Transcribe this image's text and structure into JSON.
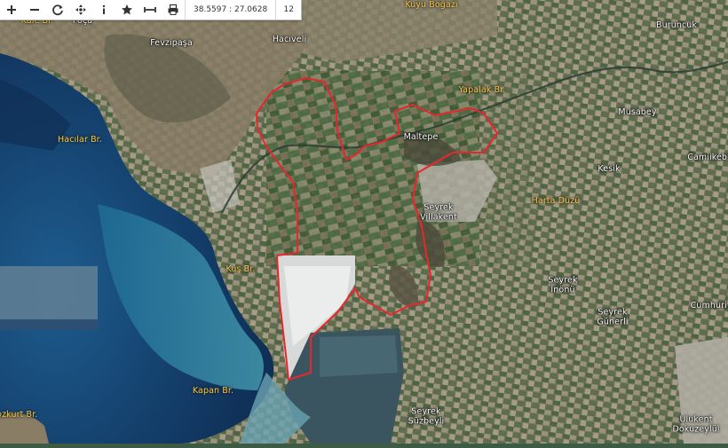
{
  "toolbar": {
    "buttons": [
      {
        "id": "zoom-in-button",
        "icon": "plus-icon",
        "label": "+"
      },
      {
        "id": "zoom-out-button",
        "icon": "minus-icon",
        "label": "−"
      },
      {
        "id": "refresh-button",
        "icon": "refresh-icon",
        "label": "↻"
      },
      {
        "id": "pan-button",
        "icon": "move-icon",
        "label": "✥"
      },
      {
        "id": "info-button",
        "icon": "info-icon",
        "label": "i"
      },
      {
        "id": "favorite-button",
        "icon": "star-icon",
        "label": "★"
      },
      {
        "id": "measure-button",
        "icon": "measure-icon",
        "label": "↔"
      },
      {
        "id": "print-button",
        "icon": "printer-icon",
        "label": "⎙"
      }
    ],
    "coordinates": "38.5597 : 27.0628",
    "zoom": "12"
  },
  "map": {
    "boundary_color": "#e8262d",
    "labels": [
      {
        "name": "Kuyu Boğazı",
        "kind": "feature"
      },
      {
        "name": "Kale Br.",
        "kind": "feature"
      },
      {
        "name": "Foça",
        "kind": "place"
      },
      {
        "name": "Fevzipaşa",
        "kind": "place"
      },
      {
        "name": "Hacıveli",
        "kind": "place"
      },
      {
        "name": "Buruncuk",
        "kind": "place"
      },
      {
        "name": "Yapalak Br.",
        "kind": "feature"
      },
      {
        "name": "Musabey",
        "kind": "place"
      },
      {
        "name": "Hacılar Br.",
        "kind": "feature"
      },
      {
        "name": "Maltepe",
        "kind": "place"
      },
      {
        "name": "Camiikebir",
        "kind": "place"
      },
      {
        "name": "Kesik",
        "kind": "place"
      },
      {
        "name": "Harta Düzü",
        "kind": "feature"
      },
      {
        "name": "Seyrek\nVillakent",
        "kind": "place"
      },
      {
        "name": "Kuş Br.",
        "kind": "feature"
      },
      {
        "name": "Seyrek\nİnönü",
        "kind": "place"
      },
      {
        "name": "Cumhuriyet",
        "kind": "place"
      },
      {
        "name": "Seyrek\nGünerli",
        "kind": "place"
      },
      {
        "name": "Kapan Br.",
        "kind": "feature"
      },
      {
        "name": "Bozkurt Br.",
        "kind": "feature"
      },
      {
        "name": "Seyrek\nSüzbeyli",
        "kind": "place"
      },
      {
        "name": "Ulukent\nDokuzeylül",
        "kind": "place"
      }
    ]
  }
}
